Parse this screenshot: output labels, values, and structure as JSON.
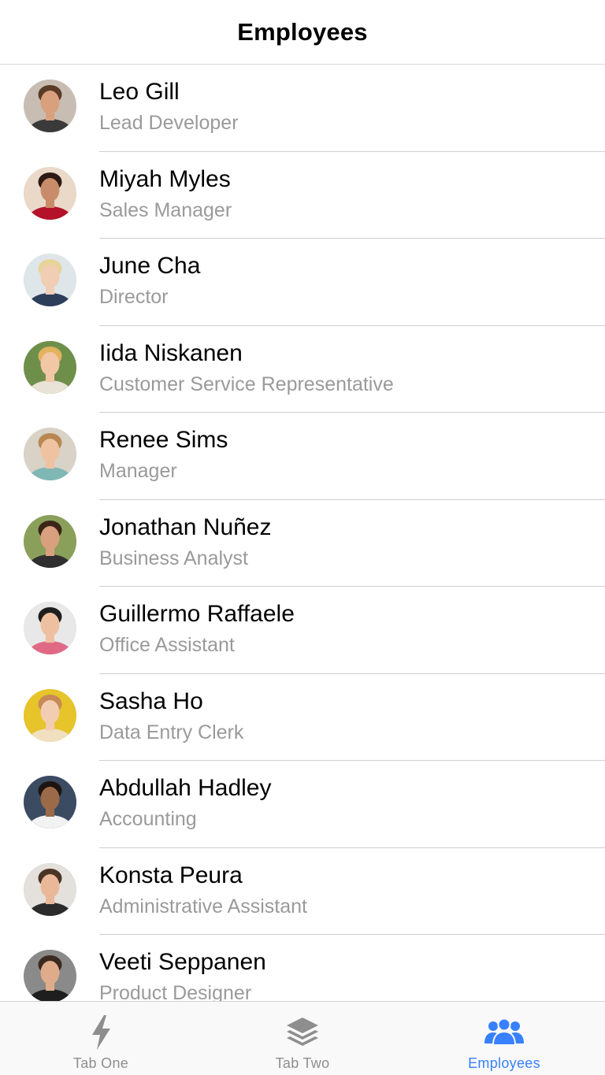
{
  "header": {
    "title": "Employees"
  },
  "employees": [
    {
      "name": "Leo Gill",
      "role": "Lead Developer",
      "skin": "#d9a07e",
      "hair": "#5a3b28",
      "shirt": "#3a3a3a",
      "bg": "#c8bdb3"
    },
    {
      "name": "Miyah Myles",
      "role": "Sales Manager",
      "skin": "#c98c6a",
      "hair": "#2c1b14",
      "shirt": "#b3122a",
      "bg": "#ead9c8"
    },
    {
      "name": "June Cha",
      "role": "Director",
      "skin": "#f0cdb3",
      "hair": "#e8d49a",
      "shirt": "#2d3e5a",
      "bg": "#dfe6ea"
    },
    {
      "name": "Iida Niskanen",
      "role": "Customer Service Representative",
      "skin": "#f2c7a5",
      "hair": "#e3b25f",
      "shirt": "#e9e2d6",
      "bg": "#6e8f4a"
    },
    {
      "name": "Renee Sims",
      "role": "Manager",
      "skin": "#efc2a2",
      "hair": "#b98852",
      "shirt": "#7fb7b5",
      "bg": "#d9d2c6"
    },
    {
      "name": "Jonathan Nuñez",
      "role": "Business Analyst",
      "skin": "#d8a07e",
      "hair": "#3b2519",
      "shirt": "#2f2f2f",
      "bg": "#8aa05a"
    },
    {
      "name": "Guillermo Raffaele",
      "role": "Office Assistant",
      "skin": "#efc0a0",
      "hair": "#1e1e1e",
      "shirt": "#e06a86",
      "bg": "#e8e8e8"
    },
    {
      "name": "Sasha Ho",
      "role": "Data Entry Clerk",
      "skin": "#f2cdb2",
      "hair": "#c78a56",
      "shirt": "#f0e0c0",
      "bg": "#e6c42a"
    },
    {
      "name": "Abdullah Hadley",
      "role": "Accounting",
      "skin": "#9b6a48",
      "hair": "#1e1410",
      "shirt": "#f2f2f2",
      "bg": "#3a4b62"
    },
    {
      "name": "Konsta Peura",
      "role": "Administrative Assistant",
      "skin": "#e8b898",
      "hair": "#4a3426",
      "shirt": "#2b2b2b",
      "bg": "#e4e0db"
    },
    {
      "name": "Veeti Seppanen",
      "role": "Product Designer",
      "skin": "#deac8a",
      "hair": "#3a2a20",
      "shirt": "#1e1e1e",
      "bg": "#8a8a8a"
    }
  ],
  "tabs": [
    {
      "label": "Tab One",
      "icon": "flash-icon",
      "active": false
    },
    {
      "label": "Tab Two",
      "icon": "layers-icon",
      "active": false
    },
    {
      "label": "Employees",
      "icon": "people-icon",
      "active": true
    }
  ],
  "colors": {
    "accent": "#3880ff",
    "inactive": "#8e8e8e",
    "role_text": "#9a9a9a"
  }
}
